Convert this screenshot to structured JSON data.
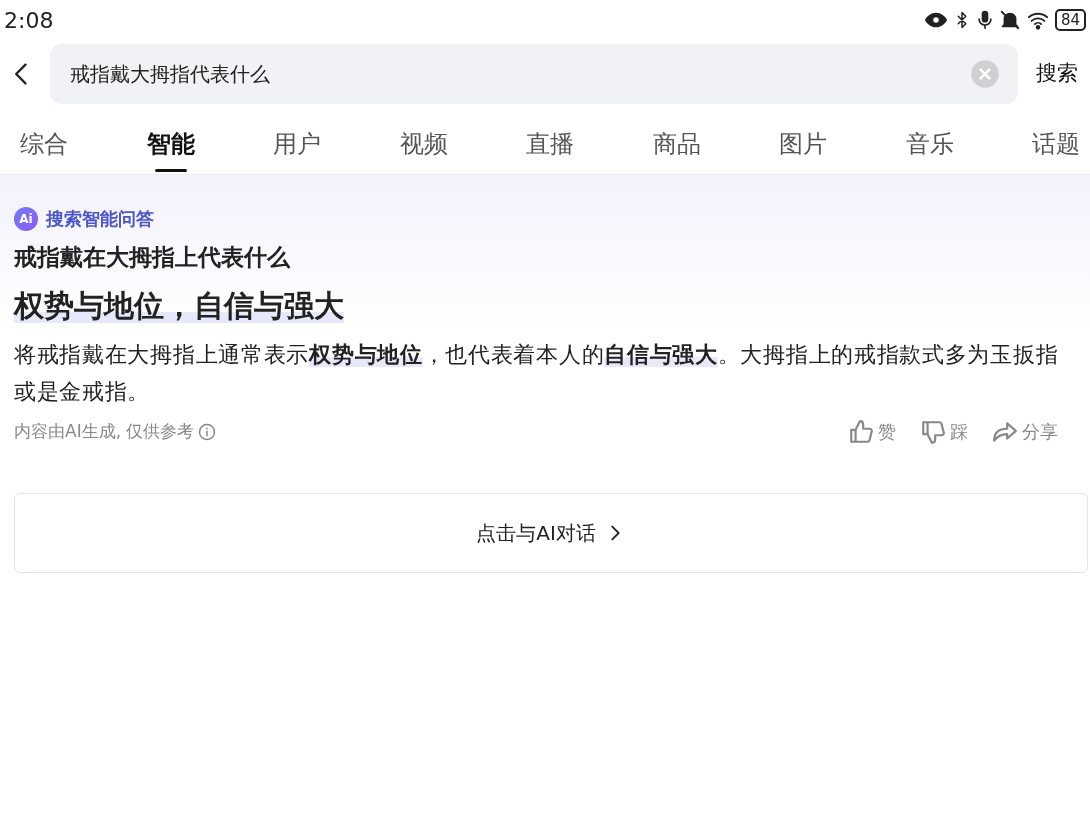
{
  "status_bar": {
    "time": "2:08",
    "battery": "84"
  },
  "search": {
    "value": "戒指戴大拇指代表什么",
    "submit": "搜索"
  },
  "tabs": [
    {
      "label": "综合",
      "selected": false
    },
    {
      "label": "智能",
      "selected": true
    },
    {
      "label": "用户",
      "selected": false
    },
    {
      "label": "视频",
      "selected": false
    },
    {
      "label": "直播",
      "selected": false
    },
    {
      "label": "商品",
      "selected": false
    },
    {
      "label": "图片",
      "selected": false
    },
    {
      "label": "音乐",
      "selected": false
    },
    {
      "label": "话题",
      "selected": false
    }
  ],
  "answer": {
    "badge_logo": "Ai",
    "badge": "搜索智能问答",
    "question": "戒指戴在大拇指上代表什么",
    "headline": "权势与地位，自信与强大",
    "body": "将戒指戴在大拇指上通常表示**权势与地位**，也代表着本人的**自信与强大**。大拇指上的戒指款式多为玉扳指或是金戒指。",
    "disclaimer": "内容由AI生成, 仅供参考",
    "actions": [
      {
        "kind": "like",
        "label": "赞"
      },
      {
        "kind": "dislike",
        "label": "踩"
      },
      {
        "kind": "share",
        "label": "分享"
      }
    ]
  },
  "chat_button": "点击与AI对话"
}
